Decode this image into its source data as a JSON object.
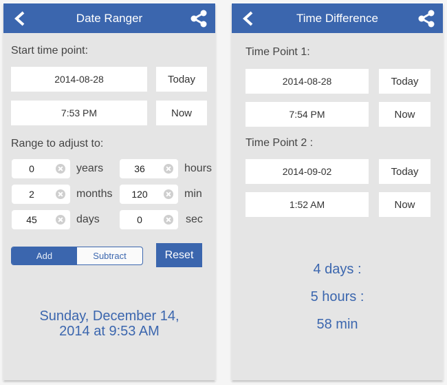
{
  "colors": {
    "accent": "#3b66ae",
    "background": "#e5e5e5"
  },
  "left": {
    "title": "Date Ranger",
    "start_label": "Start time point:",
    "start_date": "2014-08-28",
    "start_time": "7:53 PM",
    "today_label": "Today",
    "now_label": "Now",
    "range_label": "Range to adjust to:",
    "range": [
      {
        "value": "0",
        "unit": "years"
      },
      {
        "value": "2",
        "unit": "months"
      },
      {
        "value": "45",
        "unit": "days"
      },
      {
        "value": "36",
        "unit": "hours"
      },
      {
        "value": "120",
        "unit": "min"
      },
      {
        "value": "0",
        "unit": "sec"
      }
    ],
    "mode_options": [
      "Add",
      "Subtract"
    ],
    "mode_selected": "Add",
    "reset_label": "Reset",
    "result_line1": "Sunday, December 14,",
    "result_line2": "2014 at 9:53 AM"
  },
  "right": {
    "title": "Time Difference",
    "point1_label": "Time Point 1:",
    "point1_date": "2014-08-28",
    "point1_time": "7:54 PM",
    "point2_label": "Time Point 2 :",
    "point2_date": "2014-09-02",
    "point2_time": "1:52 AM",
    "today_label": "Today",
    "now_label": "Now",
    "result_days": "4 days :",
    "result_hours": "5 hours :",
    "result_min": "58 min"
  }
}
